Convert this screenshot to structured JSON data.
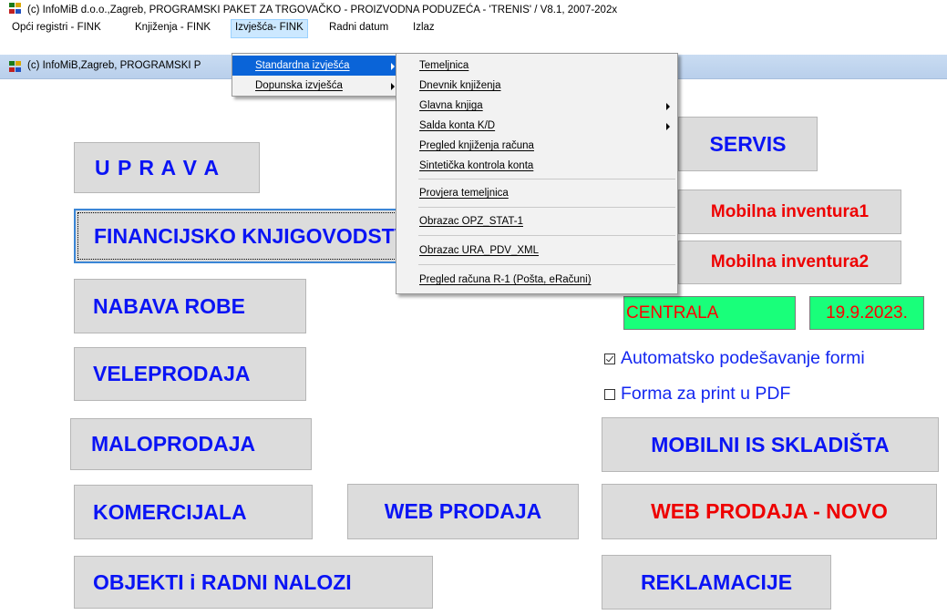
{
  "window": {
    "title": "(c) InfoMiB d.o.o.,Zagreb, PROGRAMSKI PAKET ZA TRGOVAČKO - PROIZVODNA PODUZEĆA - 'TRENIS' / V8.1, 2007-202x",
    "child_title": "(c) InfoMiB,Zagreb, PROGRAMSKI P",
    "icon": "app-icon"
  },
  "menubar": {
    "items": [
      "Opći registri - FINK",
      "Knjiženja - FINK",
      "Izvješća- FINK",
      "Radni datum",
      "Izlaz"
    ],
    "active": "Izvješća- FINK"
  },
  "submenu": {
    "items": [
      "Standardna izvješća",
      "Dopunska izvješća"
    ],
    "highlighted": "Standardna izvješća"
  },
  "submenu2": {
    "items": [
      "Temeljnica",
      "Dnevnik knjiženja",
      "Glavna knjiga",
      "Salda konta K/D",
      "Pregled knjiženja računa",
      "Sintetička kontrola konta",
      "Provjera temeljnica",
      "Obrazac OPZ_STAT-1",
      "Obrazac URA_PDV_XML",
      "Pregled računa R-1 (Pošta, eRačuni)"
    ]
  },
  "buttons": {
    "uprava": "U P R A V A",
    "financ": "FINANCIJSKO KNJIGOVODSTVO",
    "nabava": "NABAVA ROBE",
    "veleprodaja": "VELEPRODAJA",
    "maloprodaja": "MALOPRODAJA",
    "komercijala": "KOMERCIJALA",
    "web_prodaja": "WEB PRODAJA",
    "objekti": "OBJEKTI i RADNI NALOZI",
    "servis": "SERVIS",
    "mob_inv1": "Mobilna inventura1",
    "mob_inv2": "Mobilna inventura2",
    "mobilni_is": "MOBILNI IS SKLADIŠTA",
    "web_novo": "WEB PRODAJA - NOVO",
    "reklamacije": "REKLAMACIJE"
  },
  "status": {
    "location": "CENTRALA",
    "date": "19.9.2023."
  },
  "checkboxes": [
    {
      "label": "Automatsko podešavanje formi",
      "checked": true
    },
    {
      "label": "Forma za print u PDF",
      "checked": false
    }
  ],
  "colors": {
    "button_text": "#0a14f5",
    "accent_red": "#ee0000",
    "status_bg": "#19ff7a",
    "menu_highlight": "#0a64d8"
  }
}
